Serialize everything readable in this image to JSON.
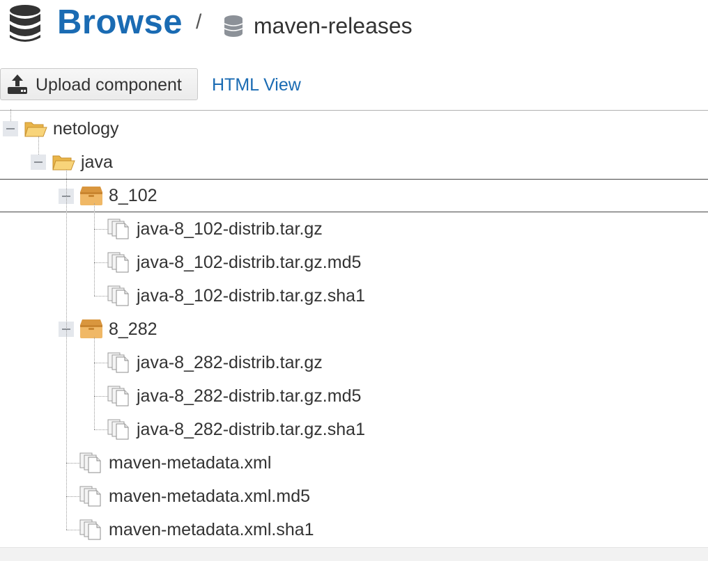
{
  "header": {
    "title": "Browse",
    "separator": "/",
    "repository": "maven-releases"
  },
  "toolbar": {
    "upload_label": "Upload component",
    "html_view_label": "HTML View"
  },
  "tree": [
    {
      "label": "netology",
      "kind": "folder",
      "depth": 0,
      "expanded": true,
      "selected": false
    },
    {
      "label": "java",
      "kind": "folder",
      "depth": 1,
      "expanded": true,
      "selected": false
    },
    {
      "label": "8_102",
      "kind": "component",
      "depth": 2,
      "expanded": true,
      "selected": true
    },
    {
      "label": "java-8_102-distrib.tar.gz",
      "kind": "asset",
      "depth": 3
    },
    {
      "label": "java-8_102-distrib.tar.gz.md5",
      "kind": "asset",
      "depth": 3
    },
    {
      "label": "java-8_102-distrib.tar.gz.sha1",
      "kind": "asset",
      "depth": 3
    },
    {
      "label": "8_282",
      "kind": "component",
      "depth": 2,
      "expanded": true,
      "selected": false
    },
    {
      "label": "java-8_282-distrib.tar.gz",
      "kind": "asset",
      "depth": 3
    },
    {
      "label": "java-8_282-distrib.tar.gz.md5",
      "kind": "asset",
      "depth": 3
    },
    {
      "label": "java-8_282-distrib.tar.gz.sha1",
      "kind": "asset",
      "depth": 3
    },
    {
      "label": "maven-metadata.xml",
      "kind": "asset",
      "depth": 2
    },
    {
      "label": "maven-metadata.xml.md5",
      "kind": "asset",
      "depth": 2
    },
    {
      "label": "maven-metadata.xml.sha1",
      "kind": "asset",
      "depth": 2
    }
  ],
  "icons": {
    "database": "database-icon",
    "upload": "upload-icon",
    "folder": "folder-open-icon",
    "component": "component-box-icon",
    "asset": "asset-files-icon",
    "toggle": "collapse-toggle-icon"
  },
  "colors": {
    "accent": "#1a6bb3",
    "folder": "#f5c04f",
    "component": "#e6a94f"
  }
}
